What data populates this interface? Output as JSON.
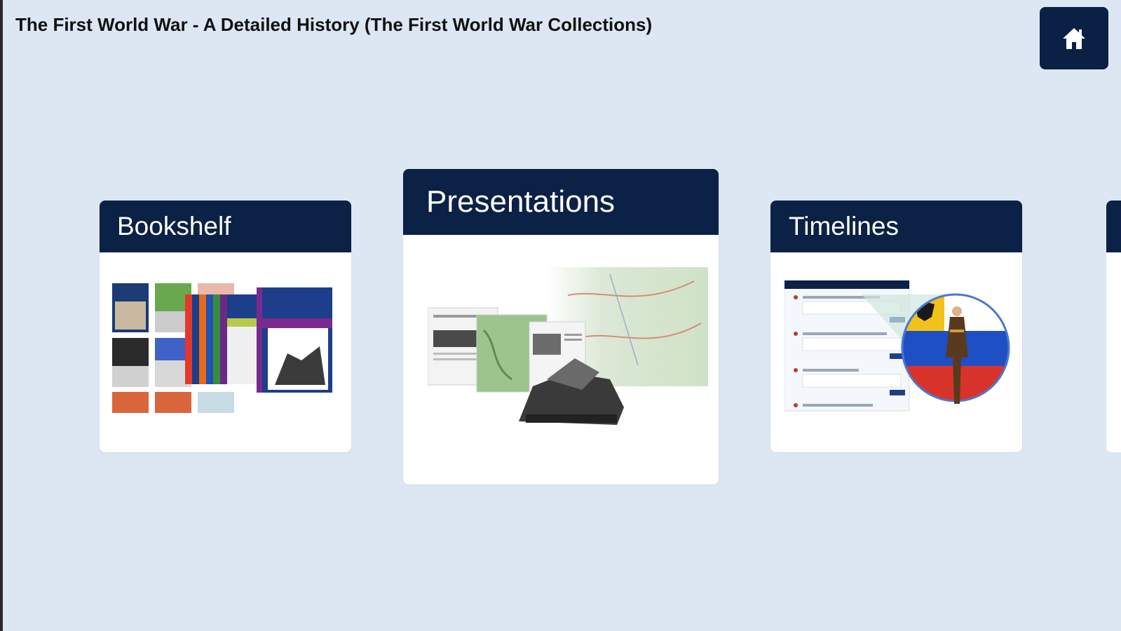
{
  "header": {
    "title": "The First World War - A Detailed History  (The First World War Collections)",
    "home_icon": "home-icon"
  },
  "cards": [
    {
      "label": "Bookshelf",
      "image": "bookshelf-thumbnail"
    },
    {
      "label": "Presentations",
      "image": "presentations-thumbnail"
    },
    {
      "label": "Timelines",
      "image": "timelines-thumbnail"
    }
  ],
  "colors": {
    "background": "#dde7f3",
    "header_navy": "#0b2146",
    "card": "#ffffff"
  }
}
